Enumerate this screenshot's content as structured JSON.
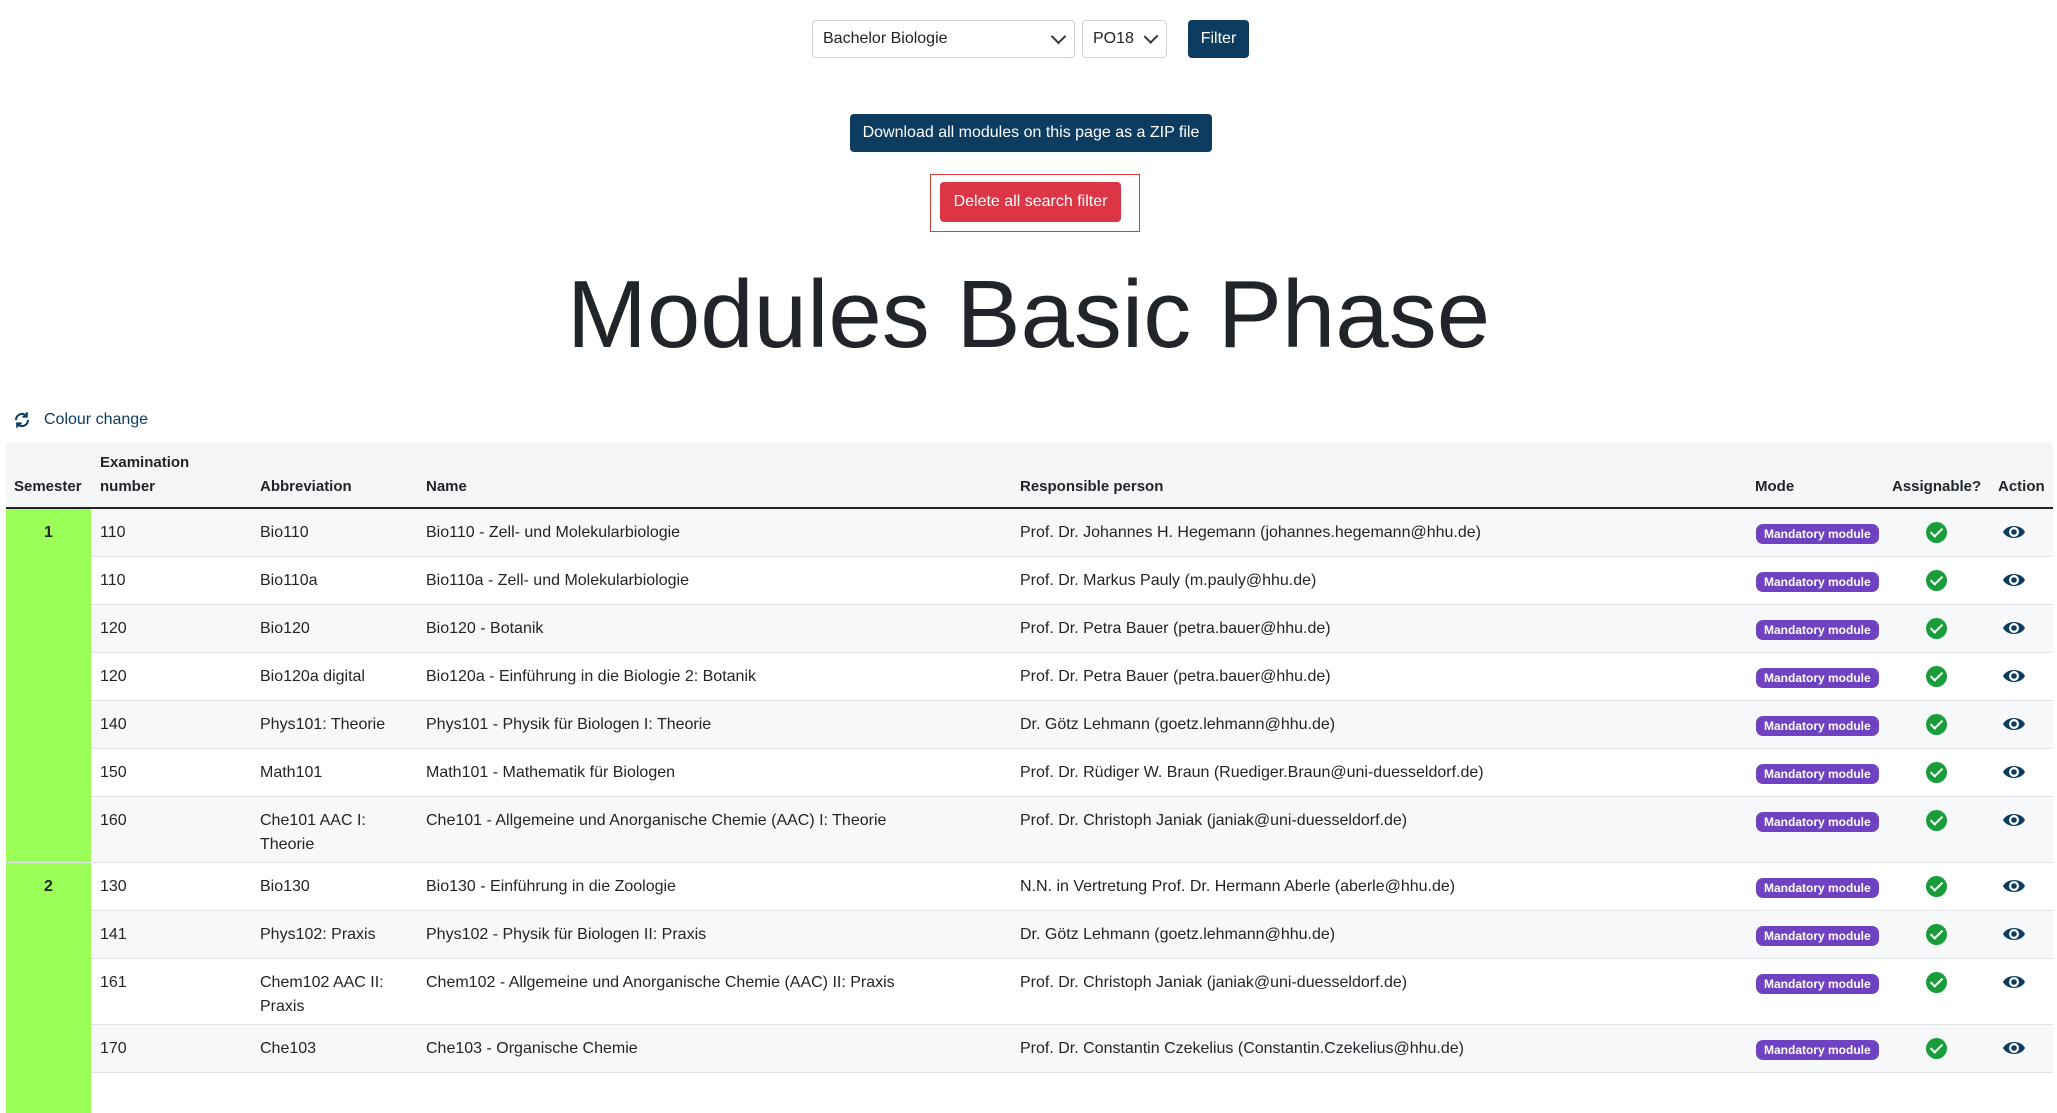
{
  "filters": {
    "program": "Bachelor Biologie",
    "regulation": "PO18",
    "filter_label": "Filter"
  },
  "download_label": "Download all modules on this page as a ZIP file",
  "delete_label": "Delete all search filter",
  "page_title": "Modules Basic Phase",
  "colour_change_label": "Colour change",
  "table": {
    "headers": {
      "semester": "Semester",
      "exam_line1": "Examination",
      "exam_line2": "number",
      "abbreviation": "Abbreviation",
      "name": "Name",
      "responsible": "Responsible person",
      "mode": "Mode",
      "assignable": "Assignable?",
      "action": "Action"
    },
    "rows": [
      {
        "semester": "1",
        "exam": "110",
        "abbr": "Bio110",
        "abbr2": "",
        "name": "Bio110 - Zell- und Molekularbiologie",
        "person": "Prof. Dr. Johannes H. Hegemann (johannes.hegemann@hhu.de)",
        "mode": "Mandatory module"
      },
      {
        "semester": "",
        "exam": "110",
        "abbr": "Bio110a",
        "abbr2": "",
        "name": "Bio110a - Zell- und Molekularbiologie",
        "person": "Prof. Dr. Markus Pauly (m.pauly@hhu.de)",
        "mode": "Mandatory module"
      },
      {
        "semester": "",
        "exam": "120",
        "abbr": "Bio120",
        "abbr2": "",
        "name": "Bio120 - Botanik",
        "person": "Prof. Dr. Petra Bauer (petra.bauer@hhu.de)",
        "mode": "Mandatory module"
      },
      {
        "semester": "",
        "exam": "120",
        "abbr": "Bio120a digital",
        "abbr2": "",
        "name": "Bio120a - Einführung in die Biologie 2: Botanik",
        "person": "Prof. Dr. Petra Bauer (petra.bauer@hhu.de)",
        "mode": "Mandatory module"
      },
      {
        "semester": "",
        "exam": "140",
        "abbr": "Phys101: Theorie",
        "abbr2": "",
        "name": "Phys101 - Physik für Biologen I: Theorie",
        "person": "Dr. Götz Lehmann (goetz.lehmann@hhu.de)",
        "mode": "Mandatory module"
      },
      {
        "semester": "",
        "exam": "150",
        "abbr": "Math101",
        "abbr2": "",
        "name": "Math101 - Mathematik für Biologen",
        "person": "Prof. Dr. Rüdiger W. Braun (Ruediger.Braun@uni-duesseldorf.de)",
        "mode": "Mandatory module"
      },
      {
        "semester": "",
        "exam": "160",
        "abbr": "Che101 AAC I:",
        "abbr2": "Theorie",
        "name": "Che101 - Allgemeine und Anorganische Chemie (AAC) I: Theorie",
        "person": "Prof. Dr. Christoph Janiak (janiak@uni-duesseldorf.de)",
        "mode": "Mandatory module"
      },
      {
        "semester": "2",
        "exam": "130",
        "abbr": "Bio130",
        "abbr2": "",
        "name": "Bio130 - Einführung in die Zoologie",
        "person": "N.N. in Vertretung Prof. Dr. Hermann Aberle (aberle@hhu.de)",
        "mode": "Mandatory module"
      },
      {
        "semester": "",
        "exam": "141",
        "abbr": "Phys102: Praxis",
        "abbr2": "",
        "name": "Phys102 - Physik für Biologen II: Praxis",
        "person": "Dr. Götz Lehmann (goetz.lehmann@hhu.de)",
        "mode": "Mandatory module"
      },
      {
        "semester": "",
        "exam": "161",
        "abbr": "Chem102 AAC II:",
        "abbr2": "Praxis",
        "name": "Chem102 - Allgemeine und Anorganische Chemie (AAC) II: Praxis",
        "person": "Prof. Dr. Christoph Janiak (janiak@uni-duesseldorf.de)",
        "mode": "Mandatory module"
      },
      {
        "semester": "",
        "exam": "170",
        "abbr": "Che103",
        "abbr2": "",
        "name": "Che103 - Organische Chemie",
        "person": "Prof. Dr. Constantin Czekelius (Constantin.Czekelius@hhu.de)",
        "mode": "Mandatory module"
      }
    ]
  },
  "colors": {
    "navy": "#0d3c61",
    "danger": "#dc3545",
    "semester_band": "#9cff57",
    "badge": "#6f42c1",
    "check": "#1a9c3a"
  },
  "icons": {
    "colour_change": "refresh-icon",
    "select": "chevron-down-icon",
    "assignable": "check-circle-icon",
    "action": "eye-icon"
  }
}
